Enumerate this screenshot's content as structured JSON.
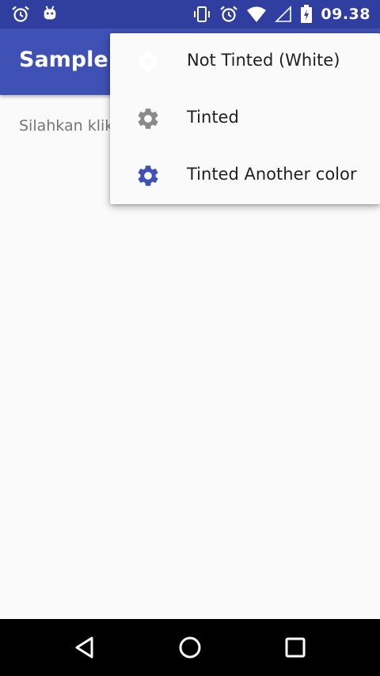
{
  "status_bar": {
    "time": "09.38",
    "left_icons": [
      "alarm-icon",
      "android-notification-icon"
    ],
    "right_icons": [
      "vibrate-icon",
      "alarm-icon",
      "wifi-icon",
      "signal-icon",
      "battery-charging-icon"
    ],
    "background": "#303f9f"
  },
  "toolbar": {
    "title": "Sample V",
    "background": "#3f51b5"
  },
  "content": {
    "text": "Silahkan klik"
  },
  "overflow_menu": {
    "items": [
      {
        "label": "Not Tinted (White)",
        "icon": "gear-icon",
        "icon_color": "#ffffff"
      },
      {
        "label": "Tinted",
        "icon": "gear-icon",
        "icon_color": "#8a8a8a"
      },
      {
        "label": "Tinted Another color",
        "icon": "gear-icon",
        "icon_color": "#3f51b5"
      }
    ]
  },
  "nav_bar": {
    "buttons": [
      "back-icon",
      "home-icon",
      "recents-icon"
    ]
  }
}
